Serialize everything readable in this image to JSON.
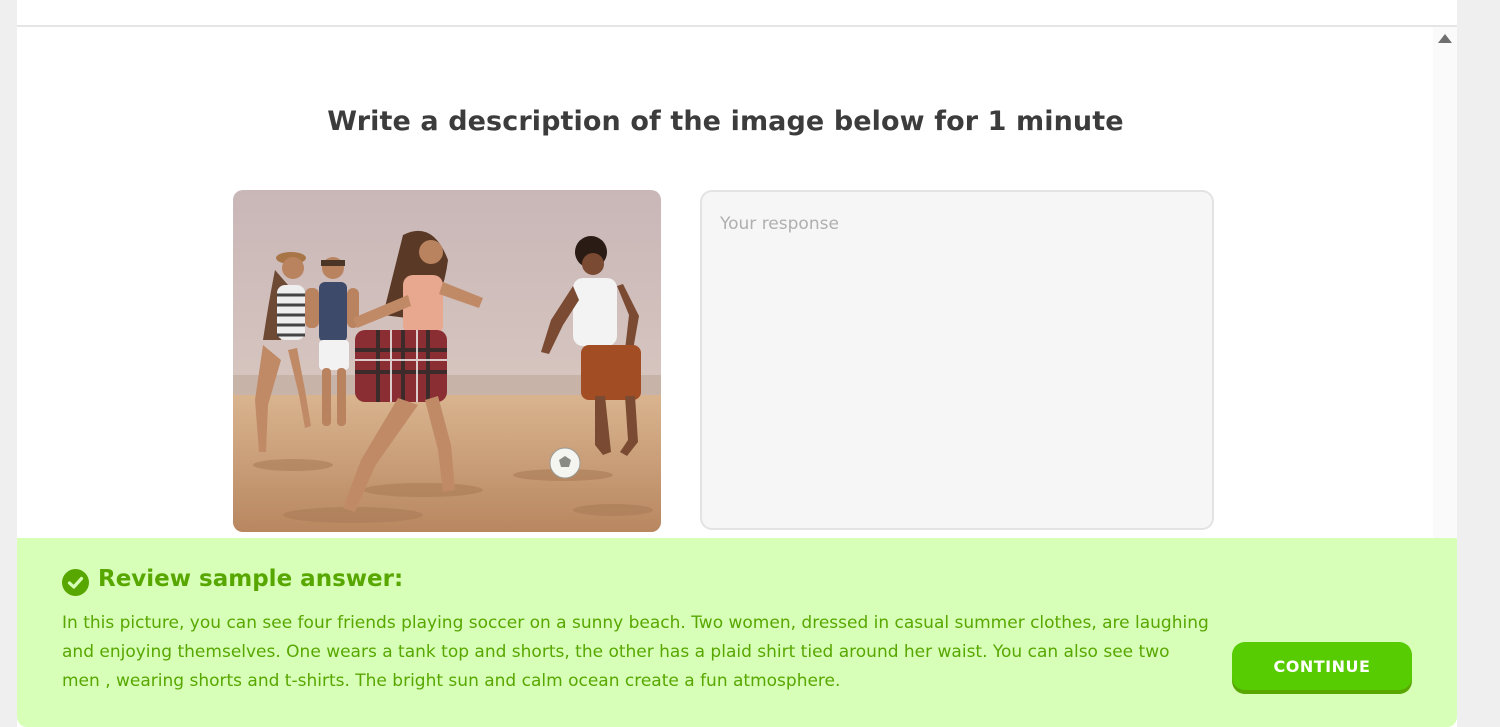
{
  "prompt": {
    "title": "Write a description of the image below for 1 minute"
  },
  "image": {
    "icon": "beach-soccer-photo"
  },
  "response": {
    "placeholder": "Your response",
    "value": ""
  },
  "feedback": {
    "icon": "check-circle-icon",
    "title": "Review sample answer:",
    "body": "In this picture, you can see four friends playing soccer on a sunny beach. Two women, dressed in casual summer clothes, are laughing and enjoying themselves. One wears a tank top and shorts, the other has a plaid shirt tied around her waist. You can also see two men , wearing shorts and t-shirts. The bright sun and calm ocean create a fun atmosphere.",
    "continue_label": "CONTINUE"
  },
  "colors": {
    "feedback_background": "#d7ffb8",
    "feedback_text": "#58a700",
    "button": "#58cc02",
    "title_text": "#3c3c3c"
  }
}
